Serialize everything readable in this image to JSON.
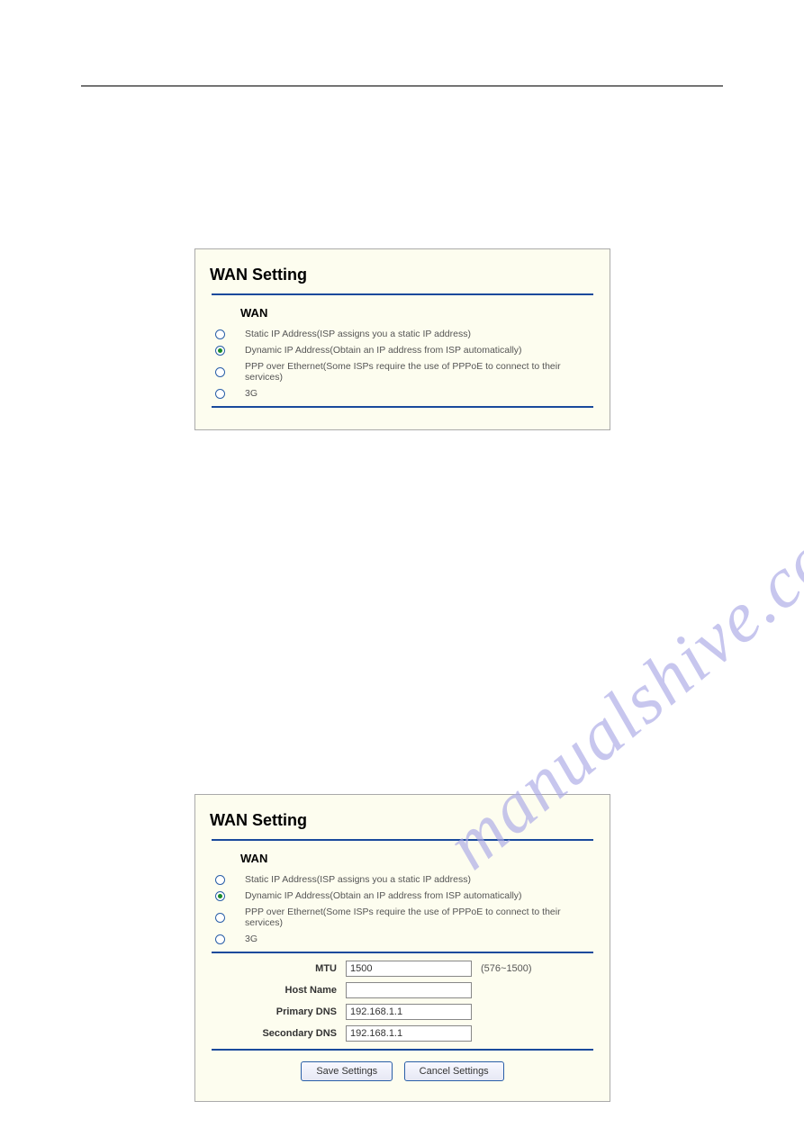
{
  "watermark": "manualshive.com",
  "panel1": {
    "title": "WAN Setting",
    "section": "WAN",
    "options": [
      "Static IP Address(ISP assigns you a static IP address)",
      "Dynamic IP Address(Obtain an IP address from ISP automatically)",
      "PPP over Ethernet(Some ISPs require the use of PPPoE to connect to their services)",
      "3G"
    ]
  },
  "panel2": {
    "title": "WAN Setting",
    "section": "WAN",
    "options": [
      "Static IP Address(ISP assigns you a static IP address)",
      "Dynamic IP Address(Obtain an IP address from ISP automatically)",
      "PPP over Ethernet(Some ISPs require the use of PPPoE to connect to their services)",
      "3G"
    ],
    "fields": {
      "mtu_label": "MTU",
      "mtu_value": "1500",
      "mtu_hint": "(576~1500)",
      "hostname_label": "Host Name",
      "hostname_value": "",
      "primary_dns_label": "Primary DNS",
      "primary_dns_value": "192.168.1.1",
      "secondary_dns_label": "Secondary DNS",
      "secondary_dns_value": "192.168.1.1"
    },
    "buttons": {
      "save": "Save Settings",
      "cancel": "Cancel Settings"
    }
  }
}
